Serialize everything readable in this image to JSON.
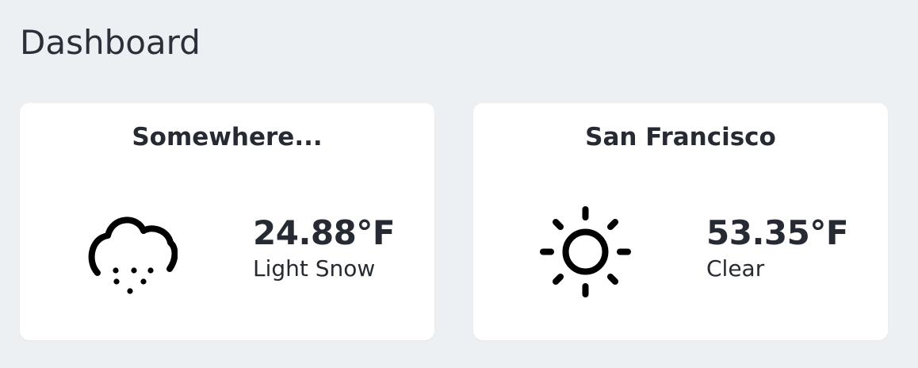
{
  "header": {
    "title": "Dashboard"
  },
  "cards": [
    {
      "location": "Somewhere...",
      "temperature": "24.88°F",
      "condition": "Light Snow",
      "icon": "snow-cloud-icon"
    },
    {
      "location": "San Francisco",
      "temperature": "53.35°F",
      "condition": "Clear",
      "icon": "sun-icon"
    }
  ],
  "colors": {
    "background": "#edf0f3",
    "card": "#ffffff",
    "text": "#262a33"
  }
}
